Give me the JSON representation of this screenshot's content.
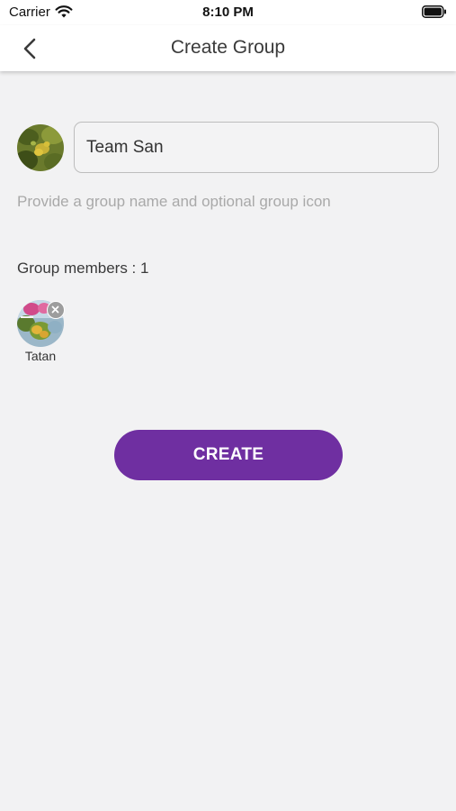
{
  "status_bar": {
    "carrier": "Carrier",
    "time": "8:10 PM",
    "icons": [
      "wifi-icon",
      "battery-icon"
    ]
  },
  "nav": {
    "back_icon": "chevron-left-icon",
    "title": "Create Group"
  },
  "form": {
    "group_icon": "group-avatar-photo",
    "group_name_value": "Team San",
    "hint": "Provide a group name and optional group icon"
  },
  "members": {
    "label": "Group members : 1",
    "items": [
      {
        "name": "Tatan",
        "avatar": "member-avatar-photo",
        "remove_icon": "close-icon"
      }
    ]
  },
  "actions": {
    "create_label": "CREATE"
  },
  "colors": {
    "accent": "#6f2fa1",
    "background": "#f2f2f3",
    "header": "#ffffff",
    "hint_text": "#a9a9a9"
  }
}
